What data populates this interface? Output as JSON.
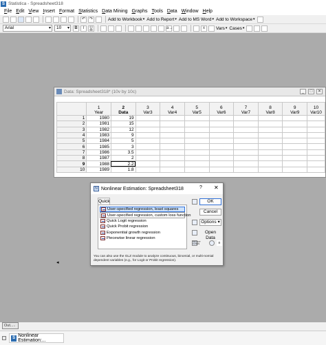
{
  "app": {
    "icon_text": "S",
    "title": "Statistica - Spreadsheet318"
  },
  "menu": [
    "File",
    "Edit",
    "View",
    "Insert",
    "Format",
    "Statistics",
    "Data Mining",
    "Graphs",
    "Tools",
    "Data",
    "Window",
    "Help"
  ],
  "toolbar": {
    "add_to_workbook": "Add to Workbook",
    "add_to_report": "Add to Report",
    "add_to_msword": "Add to MS Word",
    "add_to_workspace": "Add to Workspace",
    "font_name": "Arial",
    "font_size": "10",
    "bold": "B",
    "italic": "I",
    "underline": "U",
    "vars": "Vars",
    "cases": "Cases",
    "x_label": "x",
    "undo": "↶",
    "redo": "↷",
    "sort_label": "a→"
  },
  "sheet": {
    "window_title": "Data: Spreadsheet318* (10v by 10c)",
    "columns": [
      {
        "num": "1",
        "name": "Year"
      },
      {
        "num": "2",
        "name": "Data"
      },
      {
        "num": "3",
        "name": "Var3"
      },
      {
        "num": "4",
        "name": "Var4"
      },
      {
        "num": "5",
        "name": "Var5"
      },
      {
        "num": "6",
        "name": "Var6"
      },
      {
        "num": "7",
        "name": "Var7"
      },
      {
        "num": "8",
        "name": "Var8"
      },
      {
        "num": "9",
        "name": "Var9"
      },
      {
        "num": "10",
        "name": "Var10"
      }
    ],
    "rows": [
      {
        "id": "1",
        "year": "1980",
        "data": "19"
      },
      {
        "id": "2",
        "year": "1981",
        "data": "15"
      },
      {
        "id": "3",
        "year": "1982",
        "data": "12"
      },
      {
        "id": "4",
        "year": "1983",
        "data": "9"
      },
      {
        "id": "5",
        "year": "1984",
        "data": "5"
      },
      {
        "id": "6",
        "year": "1985",
        "data": "3"
      },
      {
        "id": "7",
        "year": "1986",
        "data": "3.5"
      },
      {
        "id": "8",
        "year": "1987",
        "data": "2"
      },
      {
        "id": "9",
        "year": "1988",
        "data": "2.2"
      },
      {
        "id": "10",
        "year": "1989",
        "data": "1.8"
      }
    ]
  },
  "dialog": {
    "title": "Nonlinear Estimation: Spreadsheet318",
    "help": "?",
    "close": "✕",
    "tab": "Quick",
    "options": [
      "User-specified regression, least squares",
      "User-specified regression, custom loss function",
      "Quick Logit regression",
      "Quick Probit regression",
      "Exponential growth regression",
      "Piecewise linear regression"
    ],
    "ok": "OK",
    "cancel": "Cancel",
    "options_btn": "Options",
    "open_data": "Open Data",
    "select_cases": "SELECT CASES",
    "note": "You can also use the GLZ module to analyze continuous, binomial, or multi-nomial dependent variables (e.g., for Logit or Probit regression)."
  },
  "minimized": {
    "label": "Out..."
  },
  "taskbar": {
    "task_label": "Nonlinear Estimation:..."
  }
}
